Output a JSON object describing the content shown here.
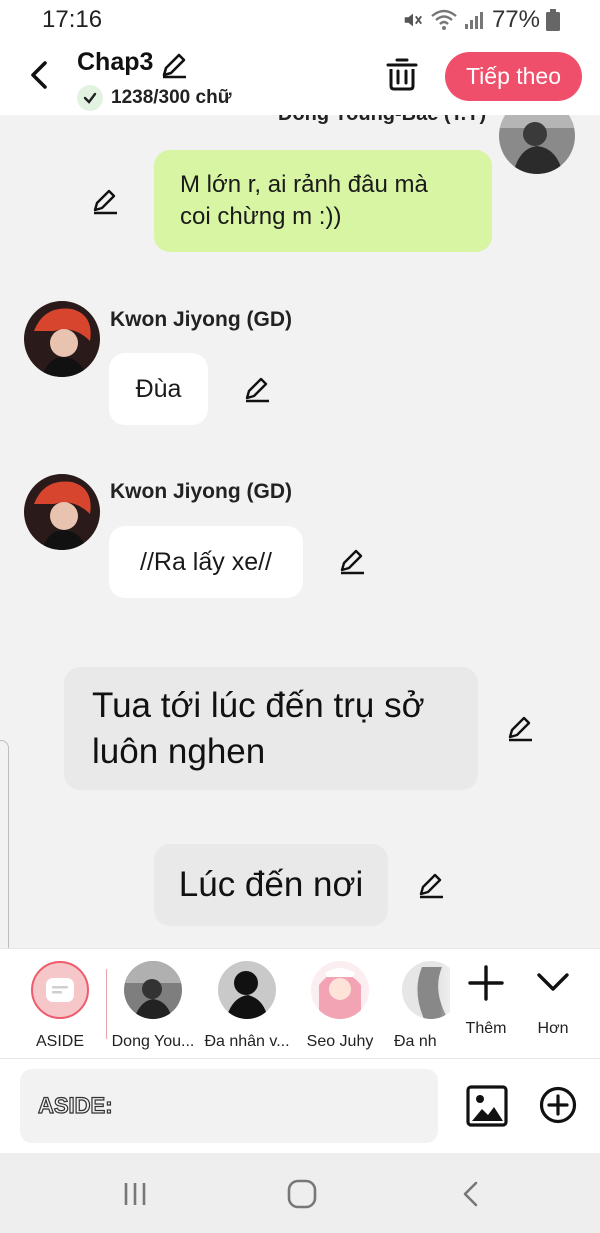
{
  "status_bar": {
    "time": "17:16",
    "battery_percent": "77%",
    "icons": [
      "mute-icon",
      "wifi-icon",
      "signal-icon",
      "battery-icon"
    ]
  },
  "header": {
    "title": "Chap3",
    "word_count": "1238/300 chữ",
    "next_label": "Tiếp theo",
    "accent_color": "#ef4f6b"
  },
  "chat": {
    "cut_off_name": "Dong Young-Bae (T.Y)",
    "messages": [
      {
        "speaker": "Dong Young-Bae (T.Y)",
        "side": "right",
        "style": "green",
        "text_line1": "M lớn r, ai rảnh đâu mà",
        "text_line2": "coi chừng m :))"
      },
      {
        "speaker": "Kwon Jiyong (GD)",
        "side": "left",
        "style": "white",
        "text": "Đùa"
      },
      {
        "speaker": "Kwon Jiyong (GD)",
        "side": "left",
        "style": "white",
        "text": "//Ra lấy xe//"
      },
      {
        "speaker": "",
        "side": "center",
        "style": "aside",
        "text_line1": "Tua tới lúc đến trụ sở",
        "text_line2": "luôn nghen"
      },
      {
        "speaker": "",
        "side": "center",
        "style": "aside",
        "text": "Lúc đến nơi"
      }
    ]
  },
  "characters": [
    {
      "name": "ASIDE",
      "selected": true
    },
    {
      "name": "Dong You..."
    },
    {
      "name": "Đa nhân v..."
    },
    {
      "name": "Seo Juhy"
    },
    {
      "name": "Đa nh"
    }
  ],
  "tools": {
    "add_label": "Thêm",
    "more_label": "Hơn"
  },
  "input": {
    "value": "ASIDE:"
  }
}
